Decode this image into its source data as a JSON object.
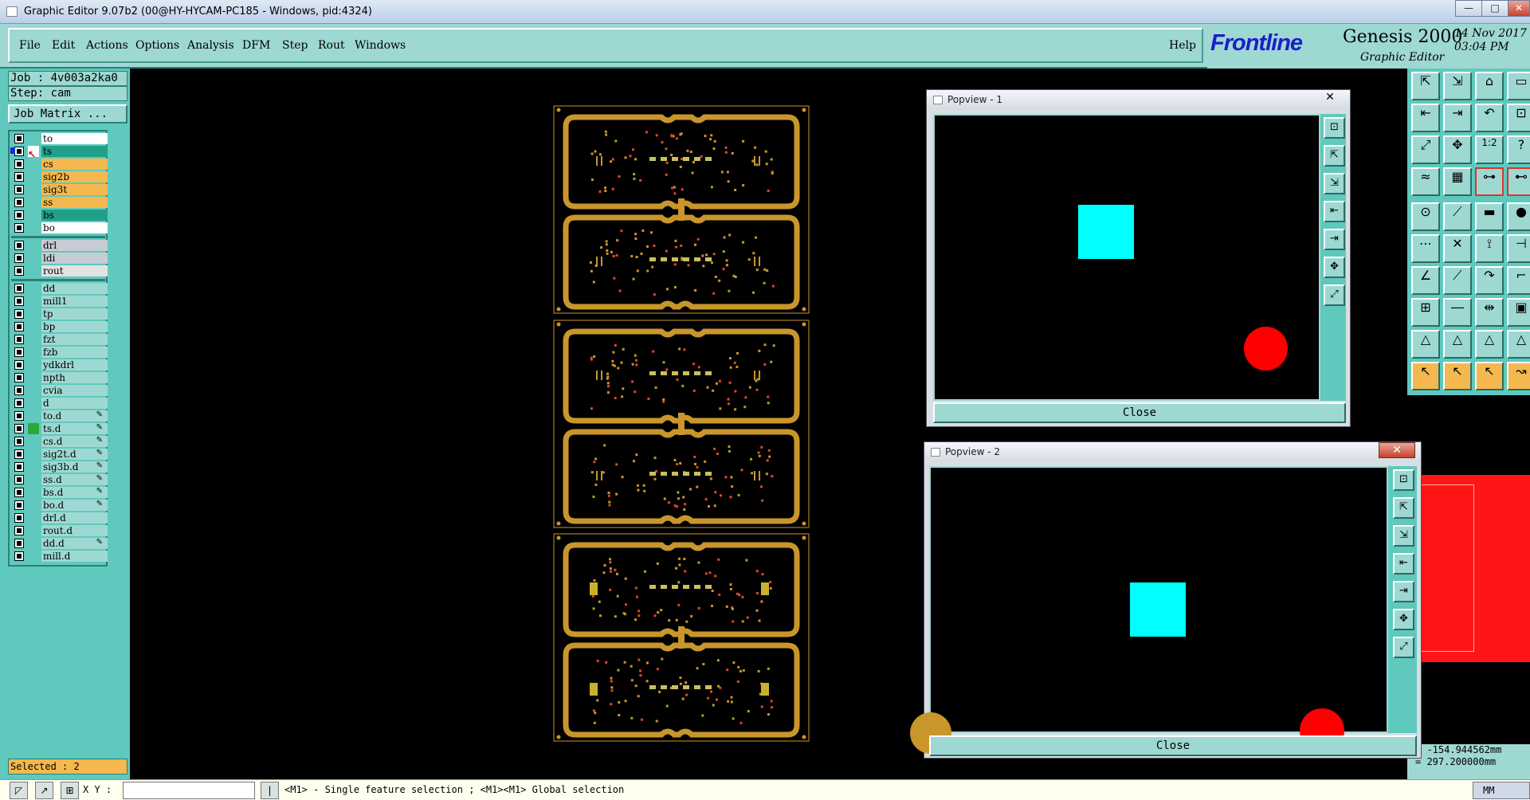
{
  "window": {
    "title": "Graphic Editor 9.07b2 (00@HY-HYCAM-PC185 - Windows, pid:4324)",
    "min": "—",
    "max": "□",
    "close": "✕"
  },
  "menu": {
    "file": "File",
    "edit": "Edit",
    "actions": "Actions",
    "options": "Options",
    "analysis": "Analysis",
    "dfm": "DFM",
    "step": "Step",
    "rout": "Rout",
    "windows": "Windows",
    "help": "Help"
  },
  "brand": {
    "logo": "Frontline",
    "product": "Genesis 2000",
    "subtitle": "Graphic Editor",
    "date": "14 Nov 2017",
    "time": "03:04 PM"
  },
  "job": {
    "job": "Job : 4v003a2ka0",
    "step": "Step: cam",
    "matrix": "Job Matrix ..."
  },
  "layers": [
    {
      "name": "to",
      "color": "#ffffff"
    },
    {
      "name": "ts",
      "color": "#20a088",
      "active": true
    },
    {
      "name": "cs",
      "color": "#f4b84e"
    },
    {
      "name": "sig2b",
      "color": "#f4b84e"
    },
    {
      "name": "sig3t",
      "color": "#f4b84e"
    },
    {
      "name": "ss",
      "color": "#f4b84e"
    },
    {
      "name": "bs",
      "color": "#20a088"
    },
    {
      "name": "bo",
      "color": "#ffffff"
    },
    {
      "name": "drl",
      "color": "#c7ccd4"
    },
    {
      "name": "ldi",
      "color": "#c7ccd4"
    },
    {
      "name": "rout",
      "color": "#e2e2e2"
    },
    {
      "name": "dd",
      "color": "#9ed8d2"
    },
    {
      "name": "mill1",
      "color": "#9ed8d2"
    },
    {
      "name": "tp",
      "color": "#9ed8d2"
    },
    {
      "name": "bp",
      "color": "#9ed8d2"
    },
    {
      "name": "fzt",
      "color": "#9ed8d2"
    },
    {
      "name": "fzb",
      "color": "#9ed8d2"
    },
    {
      "name": "ydkdrl",
      "color": "#9ed8d2"
    },
    {
      "name": "npth",
      "color": "#9ed8d2"
    },
    {
      "name": "cvia",
      "color": "#9ed8d2"
    },
    {
      "name": "d",
      "color": "#9ed8d2"
    },
    {
      "name": "to.d",
      "color": "#9ed8d2",
      "icon": "✎"
    },
    {
      "name": "ts.d",
      "color": "#9ed8d2",
      "icon": "✎",
      "greenstate": true
    },
    {
      "name": "cs.d",
      "color": "#9ed8d2",
      "icon": "✎"
    },
    {
      "name": "sig2t.d",
      "color": "#9ed8d2",
      "icon": "✎"
    },
    {
      "name": "sig3b.d",
      "color": "#9ed8d2",
      "icon": "✎"
    },
    {
      "name": "ss.d",
      "color": "#9ed8d2",
      "icon": "✎"
    },
    {
      "name": "bs.d",
      "color": "#9ed8d2",
      "icon": "✎"
    },
    {
      "name": "bo.d",
      "color": "#9ed8d2",
      "icon": "✎"
    },
    {
      "name": "drl.d",
      "color": "#9ed8d2"
    },
    {
      "name": "rout.d",
      "color": "#9ed8d2"
    },
    {
      "name": "dd.d",
      "color": "#9ed8d2",
      "icon": "✎"
    },
    {
      "name": "mill.d",
      "color": "#9ed8d2"
    }
  ],
  "selected": "Selected : 2",
  "popview1": {
    "title": "Popview - 1",
    "close": "Close"
  },
  "popview2": {
    "title": "Popview - 2",
    "close": "Close"
  },
  "coords": {
    "x": "= -154.944562mm",
    "y": "= 297.200000mm"
  },
  "status": {
    "xy_label": "X Y :",
    "prompt": "<M1> - Single feature selection ; <M1><M1> Global selection",
    "units": "MM"
  },
  "tool_icons": [
    "zoom-home-icon",
    "zoom-in-icon",
    "home-icon",
    "window-icon",
    "pan-left-icon",
    "pan-right-icon",
    "undo-zoom-icon",
    "tile-icon",
    "fit-icon",
    "center-icon",
    "ratio-icon",
    "help-icon",
    "snap-icon",
    "grid-icon",
    "measure-icon",
    "measure2-icon",
    "pad-icon",
    "line-icon",
    "ruler-icon",
    "circle-icon",
    "connect-icon",
    "cross-icon",
    "node-icon",
    "split-icon",
    "angle-icon",
    "diagonal-icon",
    "arc-icon",
    "corner-icon",
    "move-icon",
    "segment-icon",
    "stretch-icon",
    "box-icon",
    "triangle-icon",
    "triangle2-icon",
    "triangle3-icon",
    "triangle4-icon",
    "pointer-icon",
    "pointer2-icon",
    "pointer3-icon",
    "route-icon"
  ],
  "colors": {
    "panel": "#5fc9bd",
    "panel_light": "#9ed8d2",
    "board": "#c9962b",
    "cyan": "#00ffff",
    "red": "#ff0000"
  }
}
